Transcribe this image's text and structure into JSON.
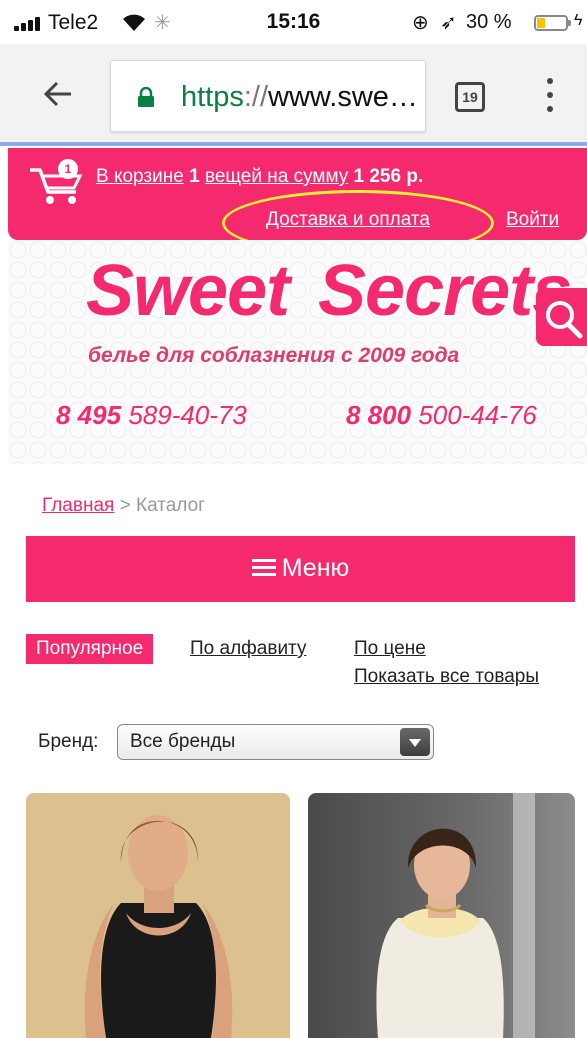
{
  "status_bar": {
    "carrier": "Tele2",
    "time": "15:16",
    "battery_percent": "30 %",
    "battery_level": 0.3
  },
  "browser": {
    "url_scheme": "https",
    "url_separator": "://",
    "url_rest": "www.swe…",
    "tab_count": "19"
  },
  "topbar": {
    "cart_link": "В корзине",
    "cart_count": "1",
    "cart_mid": "вещей на сумму",
    "cart_total": "1 256 р.",
    "delivery_link": "Доставка и оплата",
    "login_link": "Войти"
  },
  "header": {
    "logo_word1": "Sweet",
    "logo_word2": "Secrets",
    "tagline": "белье для соблазнения с 2009 года",
    "phone1_prefix": "8 495",
    "phone1_number": "589-40-73",
    "phone2_prefix": "8 800",
    "phone2_number": "500-44-76"
  },
  "breadcrumb": {
    "home": "Главная",
    "separator": ">",
    "current": "Каталог"
  },
  "menu": {
    "label": "Меню"
  },
  "sort": {
    "popular": "Популярное",
    "alphabet": "По алфавиту",
    "price": "По цене",
    "show_all": "Показать все товары"
  },
  "brand_filter": {
    "label": "Бренд:",
    "selected": "Все бренды"
  },
  "colors": {
    "brand_pink": "#f4296e",
    "highlight_yellow": "#f7ef33"
  }
}
